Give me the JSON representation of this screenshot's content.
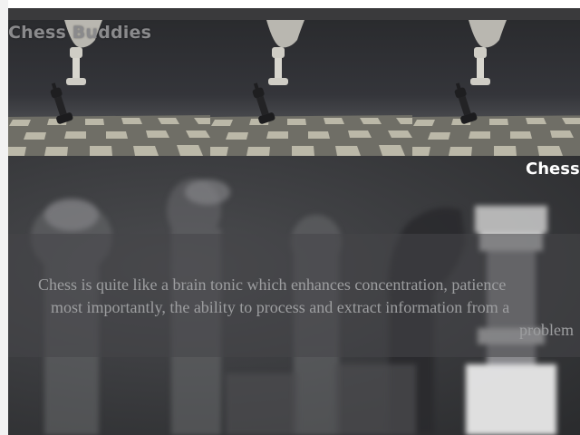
{
  "site": {
    "title": "Chess Buddies"
  },
  "hero": {
    "heading": "Chess",
    "text_lines": [
      "Chess is quite like a brain tonic which enhances concentration, patience",
      "most importantly, the ability to process and extract information from a",
      "problem"
    ]
  },
  "colors": {
    "header_strip": "#3a3a3c",
    "title_text": "#8a8a8c",
    "hero_heading": "#ffffff",
    "hero_text": "#9d9ea0"
  }
}
